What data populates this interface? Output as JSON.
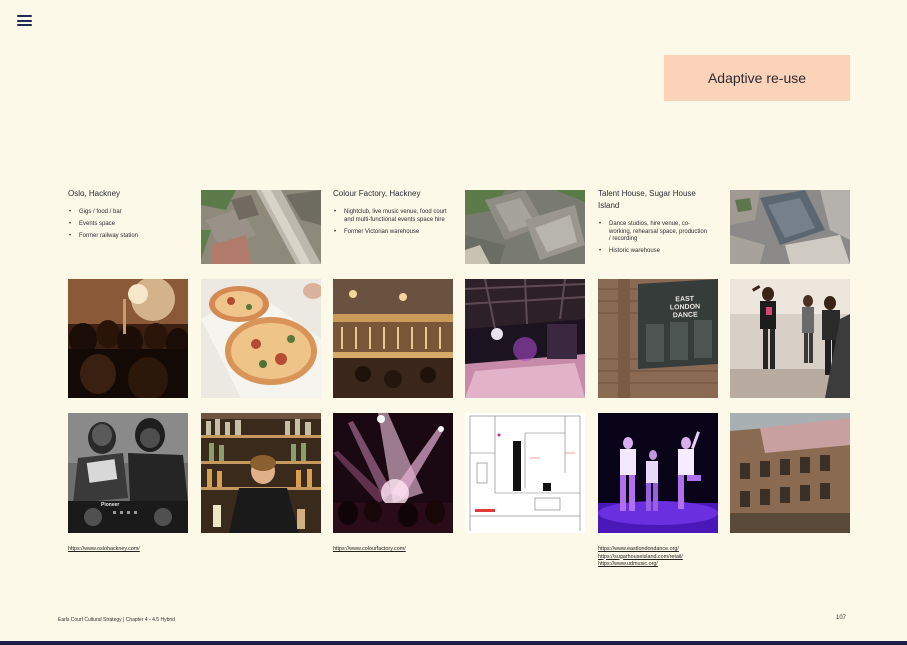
{
  "tag": {
    "label": "Adaptive re-use",
    "color": "#fbd3b8"
  },
  "venues": [
    {
      "title": "Oslo, Hackney",
      "bullets": [
        "Gigs / food / bar",
        "Events space",
        "Former railway station"
      ],
      "links": [
        "https://www.oslohackney.com/"
      ]
    },
    {
      "title": "Colour Factory, Hackney",
      "bullets": [
        "Nightclub, live music venue, food court and multi-functional events space hire",
        "Former Victorian warehouse"
      ],
      "links": [
        "https://www.colourfactory.com/"
      ]
    },
    {
      "title": "Talent House, Sugar House Island",
      "bullets": [
        "Dance studios, hire venue, co-working, rehearsal space, production / recording",
        "Historic warehouse"
      ],
      "links": [
        "https://www.eastlondondance.org/",
        "https://sugarhouseisland.com/retail/",
        "https://www.udmusic.org/"
      ]
    }
  ],
  "photo_texts": {
    "dance_sign": "EAST LONDON DANCE",
    "dj_brand": "Pioneer"
  },
  "footer": {
    "text": "Earls Court Cultural Strategy | Chapter 4 - 4.5 Hybrid",
    "page": "107"
  }
}
